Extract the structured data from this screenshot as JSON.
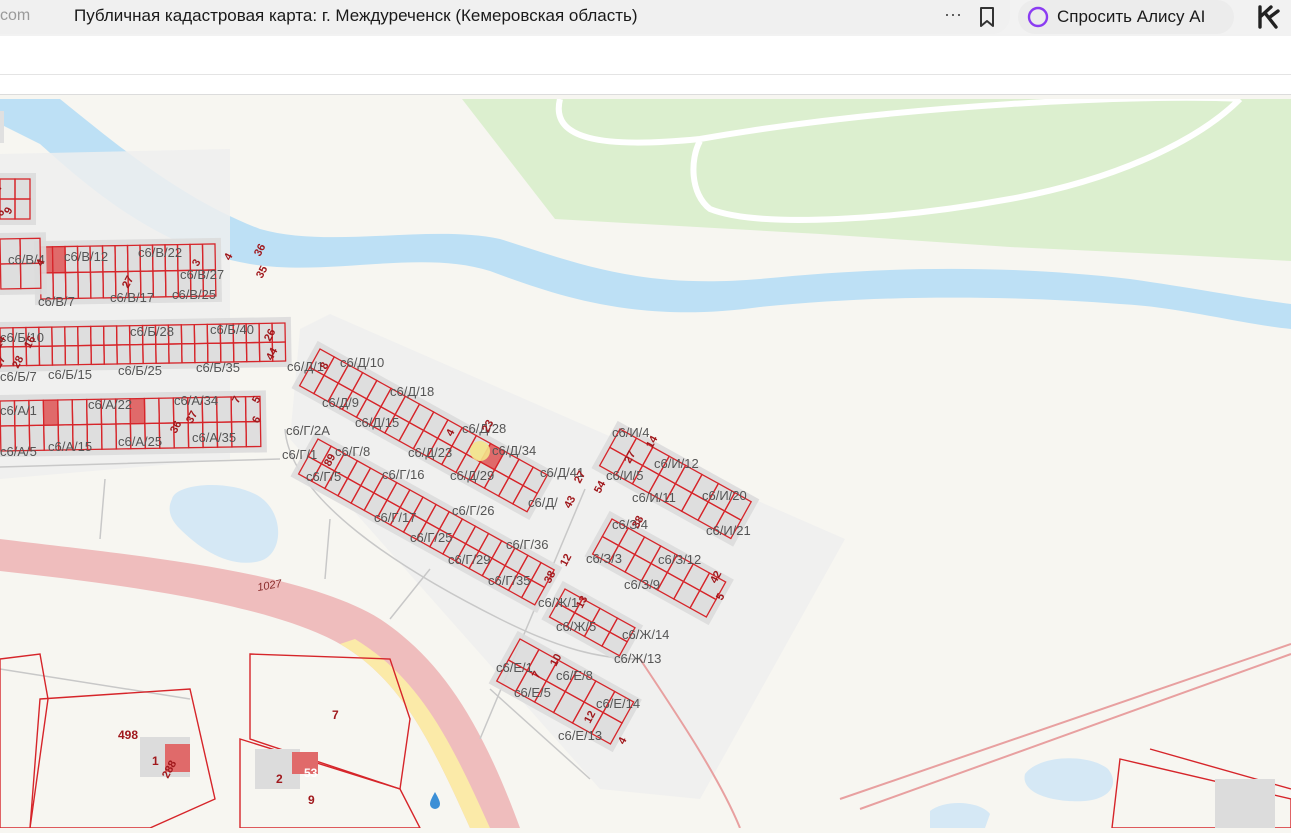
{
  "browser": {
    "domain_fragment": "com",
    "page_title": "Публичная кадастровая карта: г. Междуреченск (Кемеровская область)",
    "more_icon": "more-dots-icon",
    "bookmark_icon": "bookmark-icon",
    "alice_button_label": "Спросить Алису AI",
    "alice_icon": "alice-ring-icon",
    "extension_icon": "k-logo-icon"
  },
  "map": {
    "colors": {
      "parcel_border": "#d6252a",
      "parcel_fill": "#e06a6a",
      "building": "#dcdcdc",
      "water": "#bde0f5",
      "forest": "#dcefcf",
      "road": "#efbdbd",
      "road_yellow": "#fbeaa8",
      "label_gray": "#555555",
      "label_red": "#a0181c"
    },
    "road_label": "1027",
    "gray_labels": [
      "с6/В/4",
      "с6/В/12",
      "с6/В/22",
      "с6/В/27",
      "с6/В/7",
      "с6/В/17",
      "с6/В/25",
      "с6/Б/10",
      "с6/Б/28",
      "с6/Б/40",
      "с6/Б/7",
      "с6/Б/15",
      "с6/Б/25",
      "с6/Б/35",
      "с6/А/1",
      "с6/А/22",
      "с6/А/34",
      "с6/А/5",
      "с6/А/15",
      "с6/А/25",
      "с6/А/35",
      "с6/Д/1",
      "с6/Д/10",
      "с6/Д/9",
      "с6/Д/18",
      "с6/Д/15",
      "с6/Д/23",
      "с6/Д/28",
      "с6/Д/29",
      "с6/Д/34",
      "с6/Д/41",
      "с6/Д/",
      "с6/Г/2А",
      "с6/Г/1",
      "с6/Г/8",
      "с6/Г/5",
      "с6/Г/16",
      "с6/Г/17",
      "с6/Г/26",
      "с6/Г/25",
      "с6/Г/36",
      "с6/Г/29",
      "с6/Г/35",
      "с6/И/4",
      "с6/И/5",
      "с6/И/12",
      "с6/И/11",
      "с6/И/20",
      "с6/И/21",
      "с6/З/4",
      "с6/З/3",
      "с6/З/12",
      "с6/З/9",
      "с6/Ж/1",
      "с6/Ж/5",
      "с6/Ж/14",
      "с6/Ж/13",
      "с6/Е/1",
      "с6/Е/8",
      "с6/Е/5",
      "с6/Е/14",
      "с6/Е/13"
    ],
    "red_labels": [
      "7",
      "6",
      "9",
      "4",
      "27",
      "3",
      "4",
      "36",
      "35",
      "16",
      "14",
      "28",
      "27",
      "26",
      "44",
      "7",
      "5",
      "36",
      "37",
      "6",
      "8",
      "4",
      "23",
      "27",
      "54",
      "43",
      "89",
      "38",
      "12",
      "38",
      "42",
      "5",
      "14",
      "27",
      "13",
      "10",
      "7",
      "12",
      "4",
      "288"
    ],
    "parcel_labels": [
      "498",
      "7",
      "1",
      "2",
      "53",
      "9"
    ]
  }
}
